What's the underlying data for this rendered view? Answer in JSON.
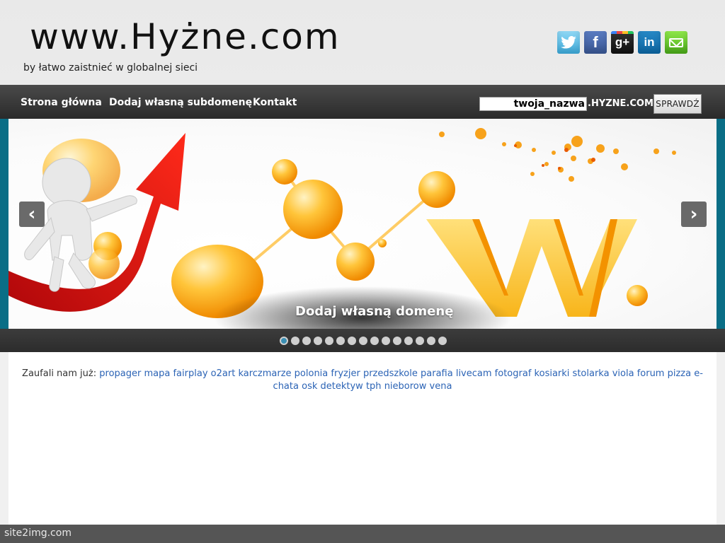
{
  "header": {
    "site_title": "www.Hyżne.com",
    "subtitle": "by łatwo zaistnieć w globalnej sieci",
    "social": [
      {
        "name": "twitter-icon",
        "glyph": "t"
      },
      {
        "name": "facebook-icon",
        "glyph": "f"
      },
      {
        "name": "google-plus-icon",
        "glyph": "g+"
      },
      {
        "name": "linkedin-icon",
        "glyph": "in"
      },
      {
        "name": "email-icon",
        "glyph": ""
      }
    ]
  },
  "nav": {
    "items": [
      "Strona główna",
      "Dodaj własną subdomenę",
      "Kontakt"
    ],
    "domain_input_value": "twoja_nazwa",
    "domain_suffix": ".HYZNE.COM",
    "check_button": "SPRAWDŹ"
  },
  "slider": {
    "caption": "Dodaj własną domenę",
    "prev": "‹",
    "next": "›",
    "slide_count": 15,
    "active_index": 0
  },
  "trusted": {
    "label": "Zaufali nam już:",
    "links": [
      "propager",
      "mapa",
      "fairplay",
      "o2art",
      "karczmarze",
      "polonia",
      "fryzjer",
      "przedszkole",
      "parafia",
      "livecam",
      "fotograf",
      "kosiarki",
      "stolarka",
      "viola",
      "forum",
      "pizza",
      "e-chata",
      "osk",
      "detektyw",
      "tph",
      "nieborow",
      "vena"
    ]
  },
  "footer": {
    "text": "site2img.com"
  },
  "colors": {
    "link": "#2b63b5",
    "nav_bg": "#2e2e2e",
    "slider_edge": "#0a6e86"
  }
}
